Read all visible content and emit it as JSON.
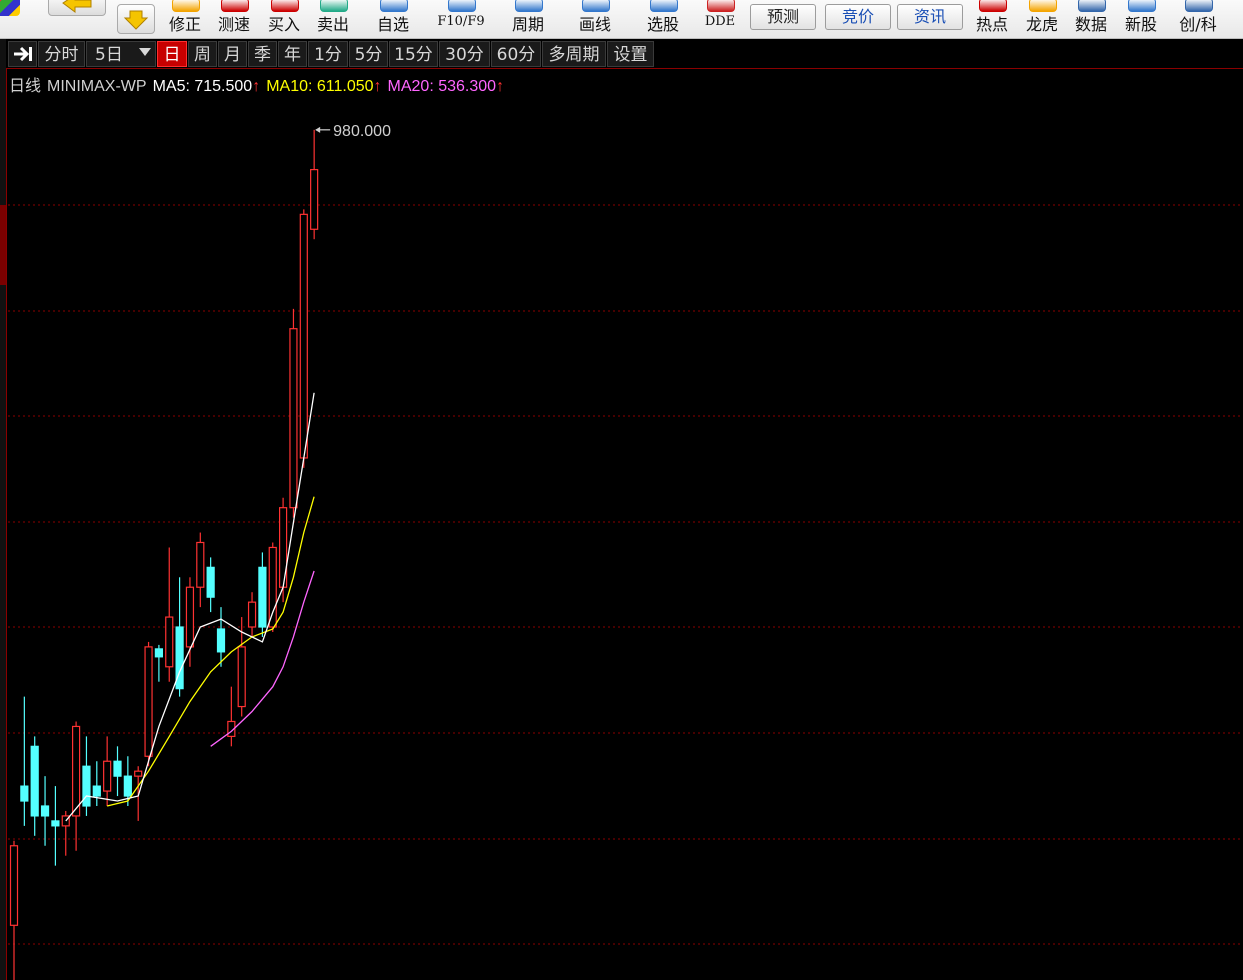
{
  "toolbar": {
    "items": [
      {
        "label": "修正",
        "kind": "icon"
      },
      {
        "label": "测速",
        "kind": "icon"
      },
      {
        "label": "买入",
        "kind": "icon"
      },
      {
        "label": "卖出",
        "kind": "icon"
      },
      {
        "label": "自选",
        "kind": "icon"
      },
      {
        "label": "F10/F9",
        "kind": "icon"
      },
      {
        "label": "周期",
        "kind": "icon"
      },
      {
        "label": "画线",
        "kind": "icon"
      },
      {
        "label": "选股",
        "kind": "icon"
      },
      {
        "label": "DDE",
        "kind": "icon"
      },
      {
        "label": "预测",
        "kind": "box"
      },
      {
        "label": "竞价",
        "kind": "box"
      },
      {
        "label": "资讯",
        "kind": "box"
      },
      {
        "label": "热点",
        "kind": "icon"
      },
      {
        "label": "龙虎",
        "kind": "icon"
      },
      {
        "label": "数据",
        "kind": "icon"
      },
      {
        "label": "新股",
        "kind": "icon"
      },
      {
        "label": "创/科",
        "kind": "icon"
      }
    ]
  },
  "period_bar": {
    "items": [
      "分时",
      "5日",
      "日",
      "周",
      "月",
      "季",
      "年",
      "1分",
      "5分",
      "15分",
      "30分",
      "60分",
      "多周期",
      "设置"
    ],
    "active": "日"
  },
  "info": {
    "period_label": "日线",
    "symbol": "MINIMAX-WP",
    "ma5_label": "MA5: 715.500",
    "ma10_label": "MA10: 611.050",
    "ma20_label": "MA20: 536.300",
    "arrow": "↑"
  },
  "colors": {
    "up": "#ff3232",
    "down": "#54ffff",
    "ma5": "#ffffff",
    "ma10": "#ffff00",
    "ma20": "#ff66ff",
    "grid": "#8b0000",
    "text": "#d0d0d0"
  },
  "chart_data": {
    "type": "candlestick",
    "ylim": [
      125,
      1010
    ],
    "high_marker": "980.000",
    "candles": [
      {
        "o": 180,
        "c": 260,
        "h": 265,
        "l": 120
      },
      {
        "o": 320,
        "c": 305,
        "h": 410,
        "l": 280
      },
      {
        "o": 360,
        "c": 290,
        "h": 370,
        "l": 270
      },
      {
        "o": 300,
        "c": 290,
        "h": 330,
        "l": 260
      },
      {
        "o": 285,
        "c": 280,
        "h": 320,
        "l": 240
      },
      {
        "o": 280,
        "c": 290,
        "h": 295,
        "l": 250
      },
      {
        "o": 290,
        "c": 380,
        "h": 385,
        "l": 255
      },
      {
        "o": 340,
        "c": 300,
        "h": 370,
        "l": 290
      },
      {
        "o": 320,
        "c": 310,
        "h": 345,
        "l": 300
      },
      {
        "o": 315,
        "c": 345,
        "h": 370,
        "l": 300
      },
      {
        "o": 345,
        "c": 330,
        "h": 360,
        "l": 310
      },
      {
        "o": 330,
        "c": 310,
        "h": 350,
        "l": 300
      },
      {
        "o": 330,
        "c": 335,
        "h": 340,
        "l": 285
      },
      {
        "o": 350,
        "c": 460,
        "h": 465,
        "l": 340
      },
      {
        "o": 458,
        "c": 450,
        "h": 462,
        "l": 425
      },
      {
        "o": 440,
        "c": 490,
        "h": 560,
        "l": 425
      },
      {
        "o": 480,
        "c": 418,
        "h": 530,
        "l": 410
      },
      {
        "o": 460,
        "c": 520,
        "h": 530,
        "l": 440
      },
      {
        "o": 520,
        "c": 565,
        "h": 575,
        "l": 500
      },
      {
        "o": 540,
        "c": 510,
        "h": 550,
        "l": 495
      },
      {
        "o": 478,
        "c": 455,
        "h": 500,
        "l": 440
      },
      {
        "o": 370,
        "c": 385,
        "h": 420,
        "l": 360
      },
      {
        "o": 400,
        "c": 460,
        "h": 490,
        "l": 390
      },
      {
        "o": 480,
        "c": 505,
        "h": 515,
        "l": 470
      },
      {
        "o": 540,
        "c": 480,
        "h": 555,
        "l": 470
      },
      {
        "o": 480,
        "c": 560,
        "h": 565,
        "l": 475
      },
      {
        "o": 520,
        "c": 600,
        "h": 610,
        "l": 505
      },
      {
        "o": 600,
        "c": 780,
        "h": 800,
        "l": 590
      },
      {
        "o": 650,
        "c": 895,
        "h": 900,
        "l": 640
      },
      {
        "o": 880,
        "c": 940,
        "h": 980,
        "l": 870
      }
    ],
    "ma5": [
      {
        "i": 5,
        "v": 285
      },
      {
        "i": 7,
        "v": 310
      },
      {
        "i": 10,
        "v": 305
      },
      {
        "i": 12,
        "v": 310
      },
      {
        "i": 14,
        "v": 380
      },
      {
        "i": 16,
        "v": 435
      },
      {
        "i": 18,
        "v": 480
      },
      {
        "i": 20,
        "v": 488
      },
      {
        "i": 22,
        "v": 475
      },
      {
        "i": 24,
        "v": 465
      },
      {
        "i": 25,
        "v": 495
      },
      {
        "i": 26,
        "v": 520
      },
      {
        "i": 27,
        "v": 585
      },
      {
        "i": 28,
        "v": 650
      },
      {
        "i": 29,
        "v": 715.5
      }
    ],
    "ma10": [
      {
        "i": 9,
        "v": 300
      },
      {
        "i": 11,
        "v": 305
      },
      {
        "i": 13,
        "v": 335
      },
      {
        "i": 15,
        "v": 370
      },
      {
        "i": 17,
        "v": 405
      },
      {
        "i": 19,
        "v": 435
      },
      {
        "i": 21,
        "v": 455
      },
      {
        "i": 23,
        "v": 470
      },
      {
        "i": 25,
        "v": 478
      },
      {
        "i": 26,
        "v": 495
      },
      {
        "i": 27,
        "v": 530
      },
      {
        "i": 28,
        "v": 575
      },
      {
        "i": 29,
        "v": 611.05
      }
    ],
    "ma20": [
      {
        "i": 19,
        "v": 360
      },
      {
        "i": 21,
        "v": 375
      },
      {
        "i": 23,
        "v": 395
      },
      {
        "i": 25,
        "v": 420
      },
      {
        "i": 26,
        "v": 440
      },
      {
        "i": 27,
        "v": 470
      },
      {
        "i": 28,
        "v": 505
      },
      {
        "i": 29,
        "v": 536.3
      }
    ]
  }
}
